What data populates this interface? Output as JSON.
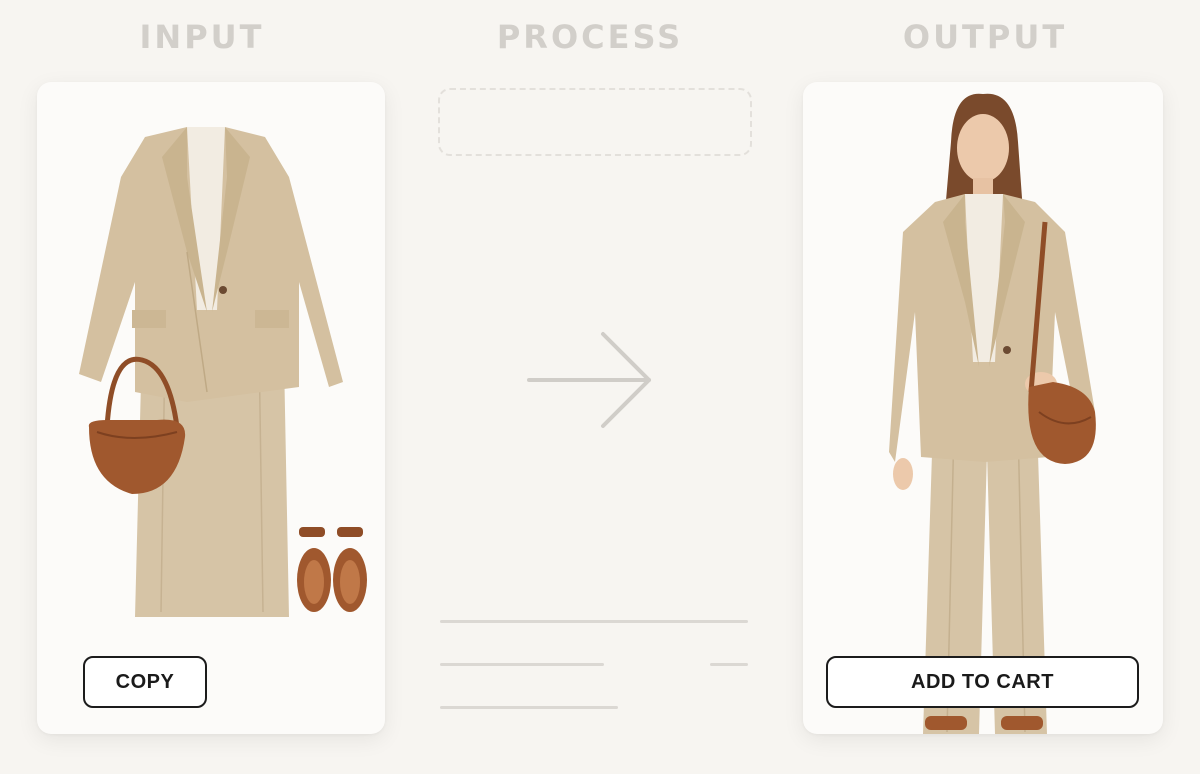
{
  "columns": {
    "input_title": "INPUT",
    "process_title": "PROCESS",
    "output_title": "OUTPUT"
  },
  "input_card": {
    "copy_label": "COPY",
    "items": [
      "blazer",
      "t-shirt",
      "trousers",
      "handbag",
      "sandals"
    ]
  },
  "output_card": {
    "add_to_cart_label": "ADD TO CART"
  },
  "colors": {
    "background": "#f7f5f1",
    "card": "#fcfbf9",
    "title": "#d2cfca",
    "beige": "#d4c0a0",
    "leather": "#a0582e",
    "button_border": "#1c1c1c"
  }
}
